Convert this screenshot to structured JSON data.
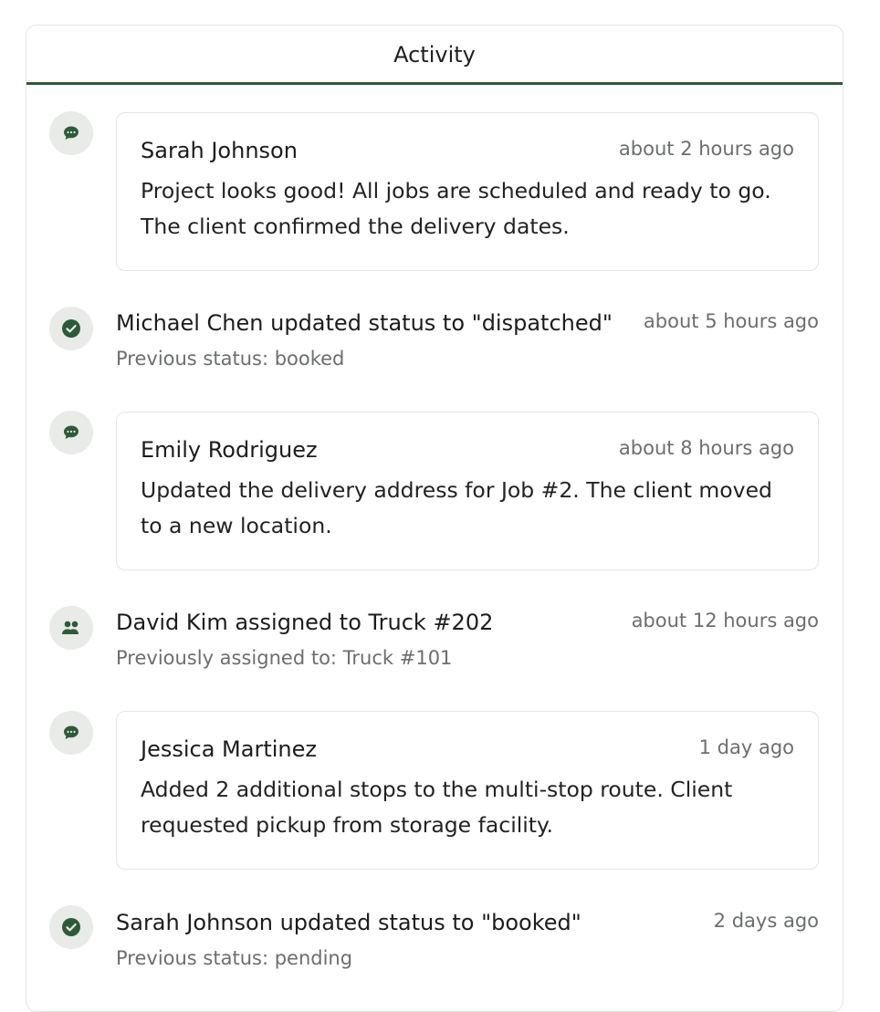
{
  "header": {
    "title": "Activity"
  },
  "colors": {
    "accent": "#2f5a3a",
    "icon_bg": "#e8ebe7",
    "muted_text": "#6b6f6b",
    "border": "#e4e6e3"
  },
  "activities": [
    {
      "type": "comment",
      "icon": "chat-bubble-icon",
      "author": "Sarah Johnson",
      "time": "about 2 hours ago",
      "body": "Project looks good! All jobs are scheduled and ready to go. The client confirmed the delivery dates."
    },
    {
      "type": "status",
      "icon": "check-circle-icon",
      "title": "Michael Chen updated status to \"dispatched\"",
      "time": "about 5 hours ago",
      "detail": "Previous status: booked"
    },
    {
      "type": "comment",
      "icon": "chat-bubble-icon",
      "author": "Emily Rodriguez",
      "time": "about 8 hours ago",
      "body": "Updated the delivery address for Job #2. The client moved to a new location."
    },
    {
      "type": "assignment",
      "icon": "users-icon",
      "title": "David Kim assigned to Truck #202",
      "time": "about 12 hours ago",
      "detail": "Previously assigned to: Truck #101"
    },
    {
      "type": "comment",
      "icon": "chat-bubble-icon",
      "author": "Jessica Martinez",
      "time": "1 day ago",
      "body": "Added 2 additional stops to the multi-stop route. Client requested pickup from storage facility."
    },
    {
      "type": "status",
      "icon": "check-circle-icon",
      "title": "Sarah Johnson updated status to \"booked\"",
      "time": "2 days ago",
      "detail": "Previous status: pending"
    }
  ]
}
